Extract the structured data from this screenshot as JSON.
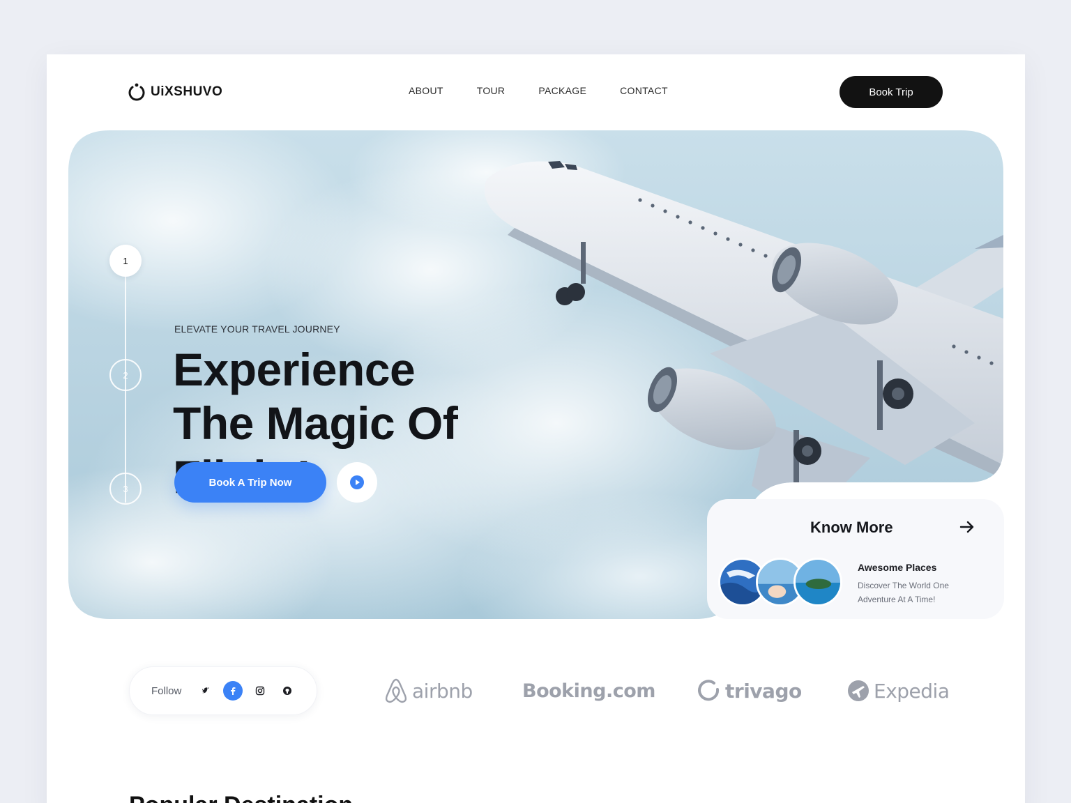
{
  "brand": {
    "name": "UiXSHUVO"
  },
  "nav": {
    "items": [
      {
        "label": "ABOUT"
      },
      {
        "label": "TOUR"
      },
      {
        "label": "PACKAGE"
      },
      {
        "label": "CONTACT"
      }
    ],
    "cta_label": "Book Trip"
  },
  "hero": {
    "eyebrow": "ELEVATE YOUR TRAVEL JOURNEY",
    "headline": [
      "Experience",
      "The Magic Of",
      "Flight!"
    ],
    "steps": [
      "1",
      "2",
      "3"
    ],
    "active_step": 1,
    "cta_label": "Book A Trip Now",
    "play_icon": "play-icon"
  },
  "know_more": {
    "title": "Know More",
    "places_title": "Awesome Places",
    "places_desc": "Discover The World One Adventure At A Time!"
  },
  "follow": {
    "label": "Follow",
    "socials": [
      "twitter-icon",
      "facebook-icon",
      "instagram-icon",
      "github-icon"
    ]
  },
  "partners": [
    {
      "name": "airbnb"
    },
    {
      "name": "Booking.com"
    },
    {
      "name": "trivago"
    },
    {
      "name": "Expedia"
    }
  ],
  "next_section": {
    "title": "Popular Destination"
  },
  "colors": {
    "accent": "#3b82f6",
    "dark": "#121212",
    "partner_gray": "#9da1ab"
  }
}
